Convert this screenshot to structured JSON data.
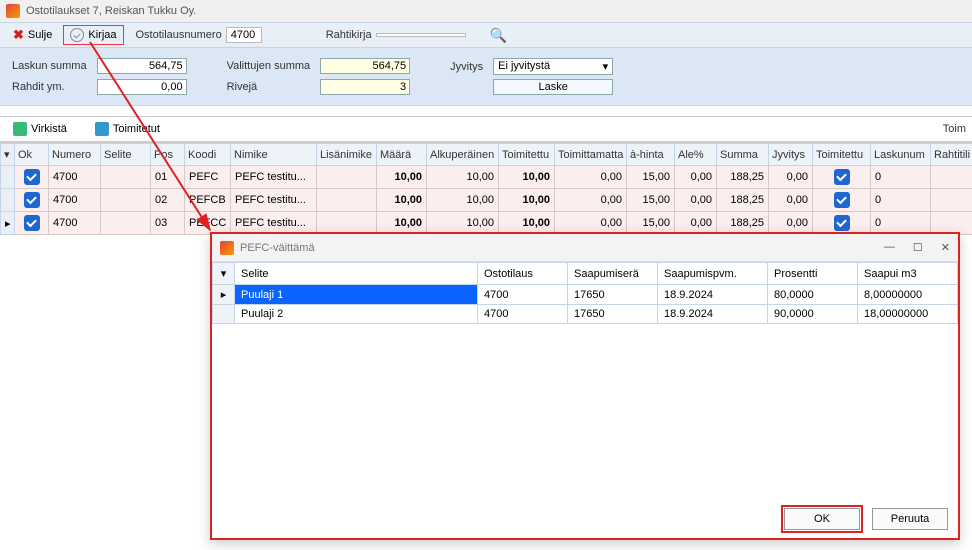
{
  "window": {
    "title": "Ostotilaukset 7, Reiskan Tukku Oy."
  },
  "toolbar": {
    "sulje": "Sulje",
    "kirjaa": "Kirjaa",
    "num_lbl": "Ostotilausnumero",
    "num_val": "4700",
    "rahtikirja_lbl": "Rahtikirja",
    "rahtikirja_val": ""
  },
  "summary": {
    "laskun_lbl": "Laskun summa",
    "laskun_val": "564,75",
    "rahdit_lbl": "Rahdit ym.",
    "rahdit_val": "0,00",
    "valittujen_lbl": "Valittujen summa",
    "valittujen_val": "564,75",
    "riveja_lbl": "Rivejä",
    "riveja_val": "3",
    "jyvitys_lbl": "Jyvitys",
    "jyvitys_val": "Ei jyvitystä",
    "laske": "Laske"
  },
  "toolbar2": {
    "virkista": "Virkistä",
    "toimitetut": "Toimitetut",
    "right": "Toim"
  },
  "grid": {
    "cols": [
      "Ok",
      "Numero",
      "Selite",
      "Pos",
      "Koodi",
      "Nimike",
      "Lisänimike",
      "Määrä",
      "Alkuperäinen määrä",
      "Toimitettu",
      "Toimittamatta",
      "à-hinta",
      "Ale%",
      "Summa",
      "Jyvitys",
      "Toimitettu",
      "Laskunum",
      "Rahtitili"
    ],
    "rows": [
      {
        "num": "4700",
        "pos": "01",
        "koodi": "PEFC",
        "nimike": "PEFC testitu...",
        "maara": "10,00",
        "alk": "10,00",
        "toim": "10,00",
        "toimtt": "0,00",
        "ahinta": "15,00",
        "ale": "0,00",
        "summa": "188,25",
        "jyv": "0,00",
        "lask": "0"
      },
      {
        "num": "4700",
        "pos": "02",
        "koodi": "PEFCB",
        "nimike": "PEFC testitu...",
        "maara": "10,00",
        "alk": "10,00",
        "toim": "10,00",
        "toimtt": "0,00",
        "ahinta": "15,00",
        "ale": "0,00",
        "summa": "188,25",
        "jyv": "0,00",
        "lask": "0"
      },
      {
        "num": "4700",
        "pos": "03",
        "koodi": "PEFCC",
        "nimike": "PEFC testitu...",
        "maara": "10,00",
        "alk": "10,00",
        "toim": "10,00",
        "toimtt": "0,00",
        "ahinta": "15,00",
        "ale": "0,00",
        "summa": "188,25",
        "jyv": "0,00",
        "lask": "0"
      }
    ]
  },
  "dialog": {
    "title": "PEFC-väittämä",
    "cols": [
      "Selite",
      "Ostotilaus",
      "Saapumiserä",
      "Saapumispvm.",
      "Prosentti",
      "Saapui m3"
    ],
    "rows": [
      {
        "selite": "Puulaji 1",
        "osto": "4700",
        "saapera": "17650",
        "pvm": "18.9.2024",
        "pros": "80,0000",
        "m3": "8,00000000"
      },
      {
        "selite": "Puulaji 2",
        "osto": "4700",
        "saapera": "17650",
        "pvm": "18.9.2024",
        "pros": "90,0000",
        "m3": "18,00000000"
      }
    ],
    "ok": "OK",
    "peruuta": "Peruuta"
  }
}
